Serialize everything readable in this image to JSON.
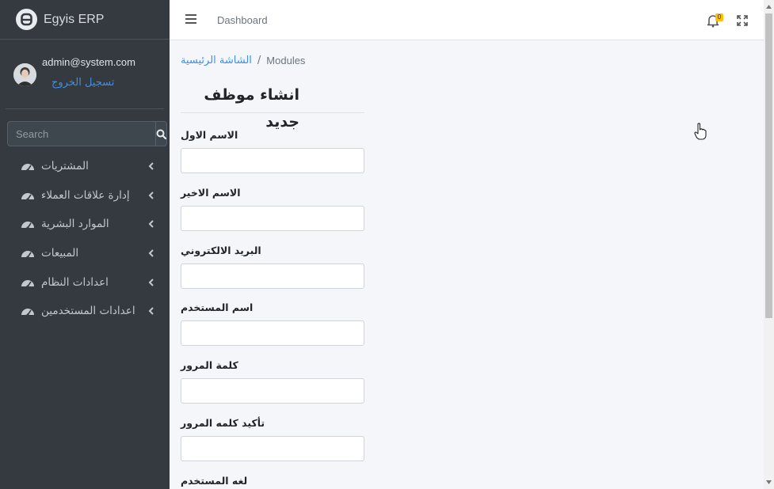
{
  "brand": {
    "name": "Egyis ERP"
  },
  "user": {
    "email": "admin@system.com",
    "logout": "تسجيل الخروج"
  },
  "search": {
    "placeholder": "Search"
  },
  "menu": [
    {
      "label": "المشتريات"
    },
    {
      "label": "إدارة علاقات العملاء"
    },
    {
      "label": "الموارد البشرية"
    },
    {
      "label": "المبيعات"
    },
    {
      "label": "اعدادات النظام"
    },
    {
      "label": "اعدادات المستخدمين"
    }
  ],
  "topbar": {
    "title": "Dashboard",
    "notification_count": "0"
  },
  "breadcrumb": {
    "home": "الشاشة الرئيسية",
    "separator": "/",
    "current": "Modules"
  },
  "page": {
    "title": "انشاء موظف جديد"
  },
  "form": {
    "fields": [
      {
        "label": "الاسم الاول",
        "value": ""
      },
      {
        "label": "الاسم الاخير",
        "value": ""
      },
      {
        "label": "البريد الالكتروني",
        "value": ""
      },
      {
        "label": "اسم المستخدم",
        "value": ""
      },
      {
        "label": "كلمة المرور",
        "value": ""
      },
      {
        "label": "تأكيد كلمه المرور",
        "value": ""
      },
      {
        "label": "لغه المستخدم",
        "value": ""
      }
    ]
  },
  "colors": {
    "sidebar": "#343a40",
    "link": "#3f8ee8",
    "badge": "#ffc107"
  }
}
